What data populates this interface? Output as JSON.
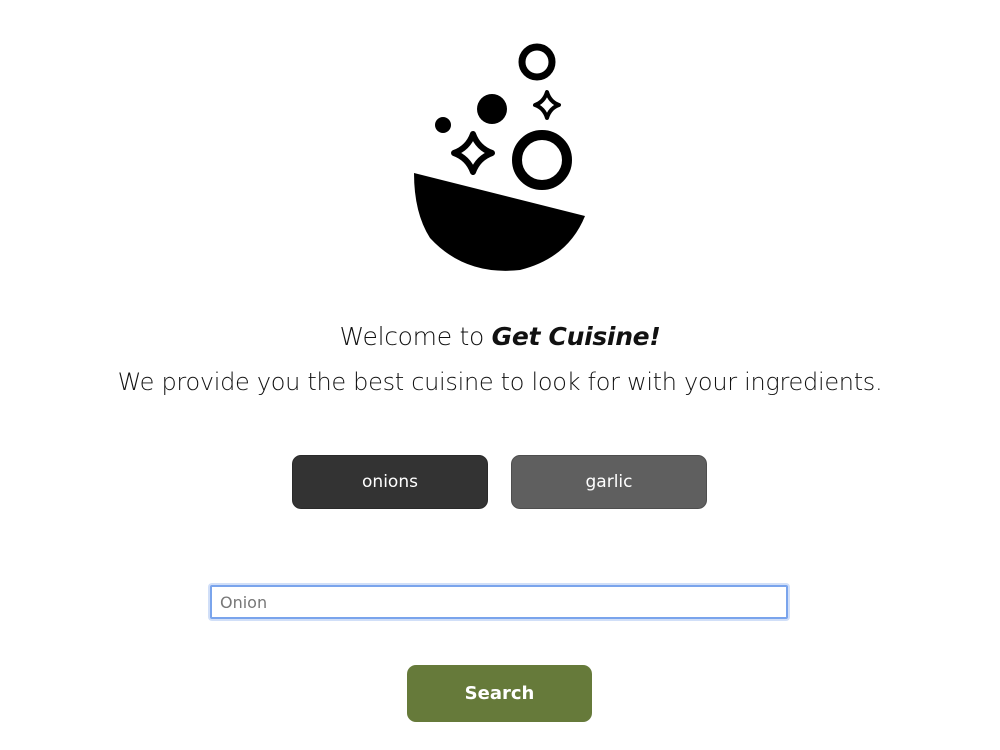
{
  "logo": {
    "icon": "cooking-bowl-icon"
  },
  "welcome": {
    "prefix": "Welcome to ",
    "brand": "Get Cuisine!"
  },
  "tagline": "We provide you the best cuisine to look for with your ingredients.",
  "ingredients": [
    {
      "label": "onions"
    },
    {
      "label": "garlic"
    }
  ],
  "search": {
    "placeholder": "Onion",
    "value": "",
    "button_label": "Search"
  },
  "colors": {
    "accent": "#667a3a",
    "chip_dark": "#333333",
    "chip_light": "#5f5f5f",
    "focus_ring": "#7aa4ec"
  }
}
